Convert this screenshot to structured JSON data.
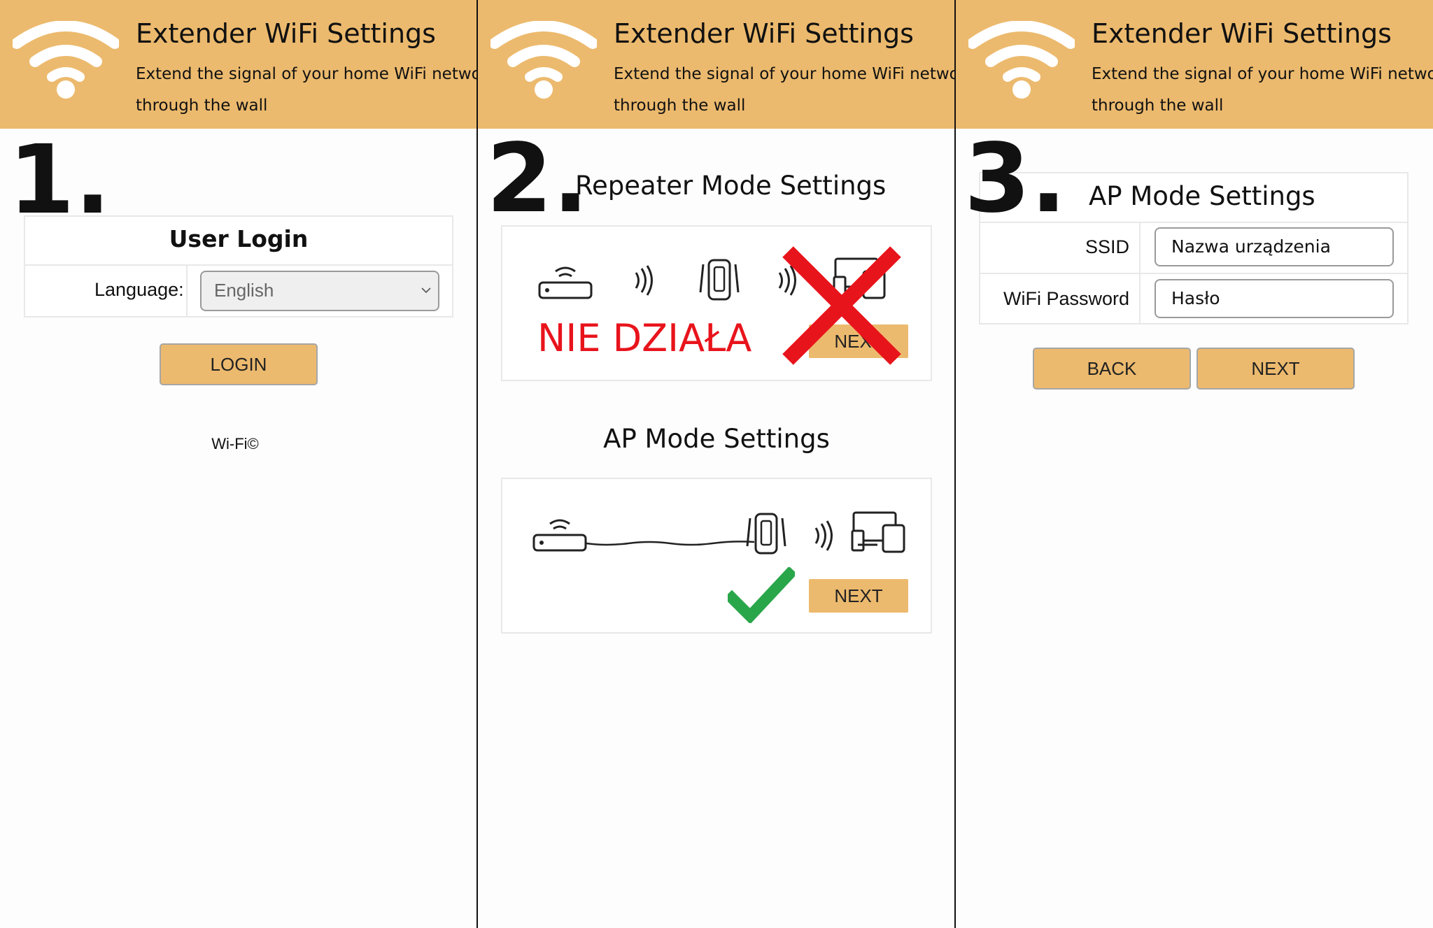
{
  "header": {
    "title": "Extender WiFi Settings",
    "subtitle_line1": "Extend the signal of your home WiFi network,",
    "subtitle_line2": "through the wall"
  },
  "panel1": {
    "step": "1.",
    "card_title": "User Login",
    "language_label": "Language:",
    "language_value": "English",
    "login_button": "LOGIN",
    "footer": "Wi-Fi©"
  },
  "panel2": {
    "step": "2.",
    "repeater_title": "Repeater Mode Settings",
    "not_working": "NIE DZIAŁA",
    "repeater_next": "NEXT",
    "ap_title": "AP Mode Settings",
    "ap_next": "NEXT"
  },
  "panel3": {
    "step": "3.",
    "title": "AP Mode Settings",
    "ssid_label": "SSID",
    "ssid_value": "Nazwa urządzenia",
    "password_label": "WiFi Password",
    "password_value": "Hasło",
    "back_button": "BACK",
    "next_button": "NEXT"
  },
  "colors": {
    "accent": "#ecba6e",
    "error": "#e8141c",
    "success": "#2aa64a"
  },
  "icons": [
    "wifi-logo-icon",
    "router-icon",
    "signal-waves-icon",
    "extender-icon",
    "devices-icon",
    "red-x-icon",
    "checkmark-icon",
    "chevron-down-icon"
  ]
}
